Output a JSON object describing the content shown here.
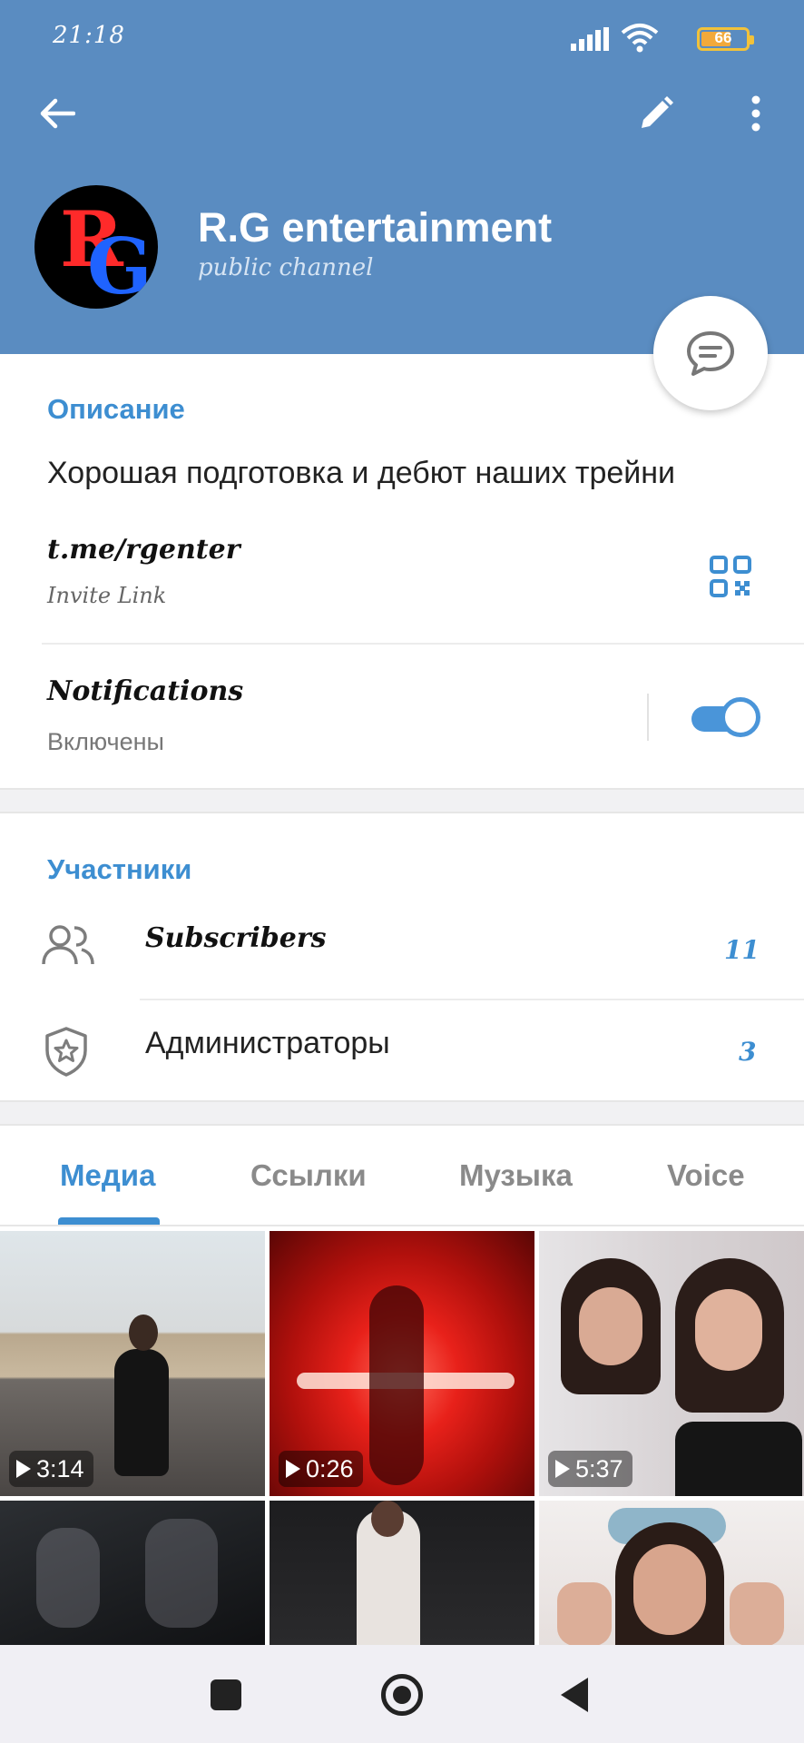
{
  "status_bar": {
    "time": "21:18",
    "battery": "66",
    "battery_level": 0.66
  },
  "header": {
    "channel_name": "R.G entertainment",
    "channel_type": "public channel",
    "avatar_letters": [
      "R",
      "G"
    ]
  },
  "description": {
    "title": "Описание",
    "text": "Хорошая подготовка и дебют наших трейни"
  },
  "invite": {
    "link": "t.me/rgenter",
    "label": "Invite Link"
  },
  "notifications": {
    "title": "Notifications",
    "status": "Включены",
    "enabled": true
  },
  "members": {
    "title": "Участники",
    "rows": [
      {
        "label": "Subscribers",
        "count": "11"
      },
      {
        "label": "Администраторы",
        "count": "3"
      }
    ]
  },
  "tabs": [
    {
      "label": "Медиа",
      "active": true
    },
    {
      "label": "Ссылки",
      "active": false
    },
    {
      "label": "Музыка",
      "active": false
    },
    {
      "label": "Voice",
      "active": false
    }
  ],
  "media": [
    {
      "duration": "3:14"
    },
    {
      "duration": "0:26"
    },
    {
      "duration": "5:37"
    },
    {
      "duration": ""
    },
    {
      "duration": ""
    },
    {
      "duration": ""
    }
  ],
  "colors": {
    "header": "#5a8cc1",
    "accent": "#3d8ed1",
    "toggle": "#4a95d9"
  }
}
